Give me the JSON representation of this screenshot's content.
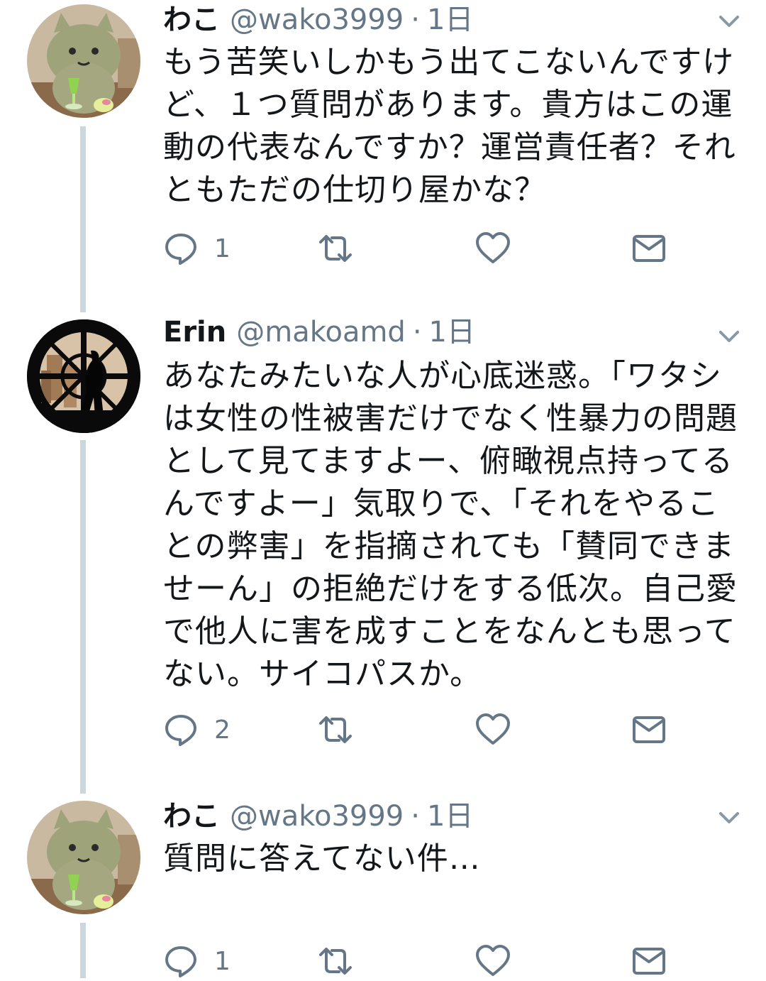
{
  "tweets": [
    {
      "name": "わこ",
      "handle": "@wako3999",
      "separator": "·",
      "time": "1日",
      "text": "もう苦笑いしかもう出てこないんですけど、１つ質問があります。貴方はこの運動の代表なんですか？運営責任者？それともただの仕切り屋かな？",
      "reply_count": "1",
      "avatar_icon": "cat-avatar-icon"
    },
    {
      "name": "Erin",
      "handle": "@makoamd",
      "separator": "·",
      "time": "1日",
      "text": "あなたみたいな人が心底迷惑。「ワタシは女性の性被害だけでなく性暴力の問題として見てますよー、俯瞰視点持ってるんですよー」気取りで、「それをやることの弊害」を指摘されても「賛同できませーん」の拒絶だけをする低次。自己愛で他人に害を成すことをなんとも思ってない。サイコパスか。",
      "reply_count": "2",
      "avatar_icon": "window-silhouette-avatar-icon"
    },
    {
      "name": "わこ",
      "handle": "@wako3999",
      "separator": "·",
      "time": "1日",
      "text": "質問に答えてない件…",
      "reply_count": "1",
      "avatar_icon": "cat-avatar-icon"
    }
  ],
  "colors": {
    "text": "#14171a",
    "secondary": "#657786",
    "thread_line": "#ccd6dd"
  }
}
